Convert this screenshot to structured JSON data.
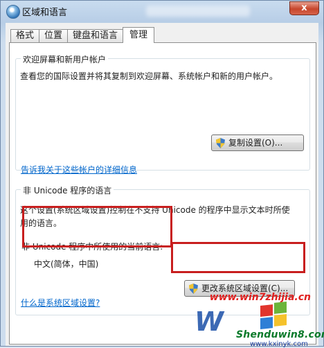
{
  "window": {
    "title": "区域和语言",
    "close_label": "x"
  },
  "tabs": [
    {
      "label": "格式"
    },
    {
      "label": "位置"
    },
    {
      "label": "键盘和语言"
    },
    {
      "label": "管理",
      "active": true
    }
  ],
  "welcome_group": {
    "title": "欢迎屏幕和新用户帐户",
    "description": "查看您的国际设置并将其复制到欢迎屏幕、系统帐户和新的用户帐户。",
    "copy_button": "复制设置(O)...",
    "link": "告诉我关于这些帐户的详细信息"
  },
  "unicode_group": {
    "title": "非 Unicode 程序的语言",
    "description_line1": "这个设置(系统区域设置)控制在不支持 Unicode 的程序中显示文本时所使",
    "description_line2": "用的语言。",
    "current_label": "非 Unicode 程序中所使用的当前语言:",
    "current_value": "中文(简体，中国)",
    "change_button": "更改系统区域设置(C)...",
    "link": "什么是系统区域设置?"
  },
  "watermarks": {
    "site1": "www.win7zhijia.cn",
    "site2": "Shenduwin8.com",
    "site3": "www.kxinyk.com"
  },
  "colors": {
    "highlight_box": "#c81e1e",
    "link": "#0066cc"
  }
}
